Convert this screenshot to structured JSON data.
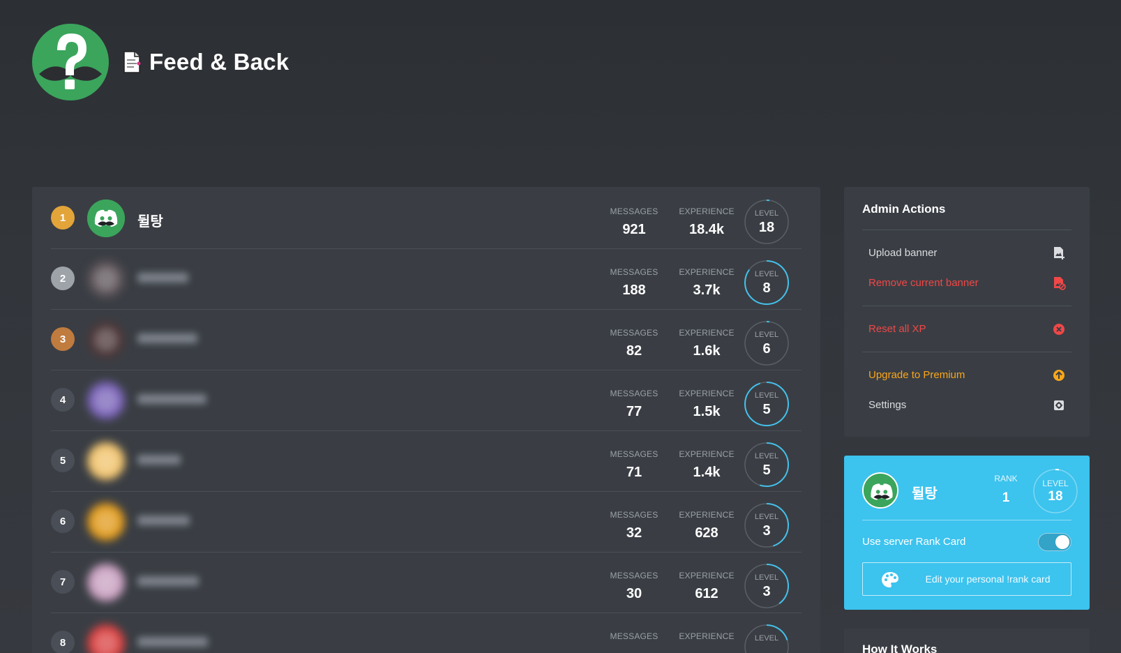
{
  "header": {
    "title": "Feed & Back",
    "server_icon": "question-mustache-icon",
    "doc_icon": "document-icon"
  },
  "leaderboard": {
    "labels": {
      "messages": "MESSAGES",
      "experience": "EXPERIENCE",
      "level": "LEVEL"
    },
    "rows": [
      {
        "rank": "1",
        "name": "뒬탕",
        "messages": "921",
        "experience": "18.4k",
        "level": "18",
        "progress": 0.02,
        "badge_color": "#e3a43a",
        "blurred": false,
        "avatar_color": "#3ba55c"
      },
      {
        "rank": "2",
        "name": "",
        "messages": "188",
        "experience": "3.7k",
        "level": "8",
        "progress": 0.85,
        "badge_color": "#9ea3aa",
        "blurred": true,
        "avatar_color": "#5b5257"
      },
      {
        "rank": "3",
        "name": "",
        "messages": "82",
        "experience": "1.6k",
        "level": "6",
        "progress": 0.02,
        "badge_color": "#c07b3f",
        "blurred": true,
        "avatar_color": "#4b3638"
      },
      {
        "rank": "4",
        "name": "",
        "messages": "77",
        "experience": "1.5k",
        "level": "5",
        "progress": 0.95,
        "badge_color": "#4a4e56",
        "blurred": true,
        "avatar_color": "#7a63b8"
      },
      {
        "rank": "5",
        "name": "",
        "messages": "71",
        "experience": "1.4k",
        "level": "5",
        "progress": 0.55,
        "badge_color": "#4a4e56",
        "blurred": true,
        "avatar_color": "#f0c36d"
      },
      {
        "rank": "6",
        "name": "",
        "messages": "32",
        "experience": "628",
        "level": "3",
        "progress": 0.45,
        "badge_color": "#4a4e56",
        "blurred": true,
        "avatar_color": "#e09a1c"
      },
      {
        "rank": "7",
        "name": "",
        "messages": "30",
        "experience": "612",
        "level": "3",
        "progress": 0.4,
        "badge_color": "#4a4e56",
        "blurred": true,
        "avatar_color": "#c9a0c0"
      },
      {
        "rank": "8",
        "name": "",
        "messages": "",
        "experience": "",
        "level": "",
        "progress": 0.2,
        "badge_color": "#4a4e56",
        "blurred": true,
        "avatar_color": "#d94040"
      }
    ]
  },
  "admin": {
    "title": "Admin Actions",
    "upload_banner": "Upload banner",
    "remove_banner": "Remove current banner",
    "reset_xp": "Reset all XP",
    "upgrade": "Upgrade to Premium",
    "settings": "Settings"
  },
  "rank_card": {
    "name": "뒬탕",
    "rank_label": "RANK",
    "rank": "1",
    "level_label": "LEVEL",
    "level": "18",
    "toggle_label": "Use server Rank Card",
    "toggle_on": true,
    "edit_label": "Edit your personal !rank card"
  },
  "how": {
    "title": "How It Works"
  },
  "colors": {
    "accent": "#3cc3ee",
    "ring": "#44c1ec",
    "danger": "#f04747",
    "premium": "#faa61a",
    "discord_green": "#3ba55c"
  }
}
